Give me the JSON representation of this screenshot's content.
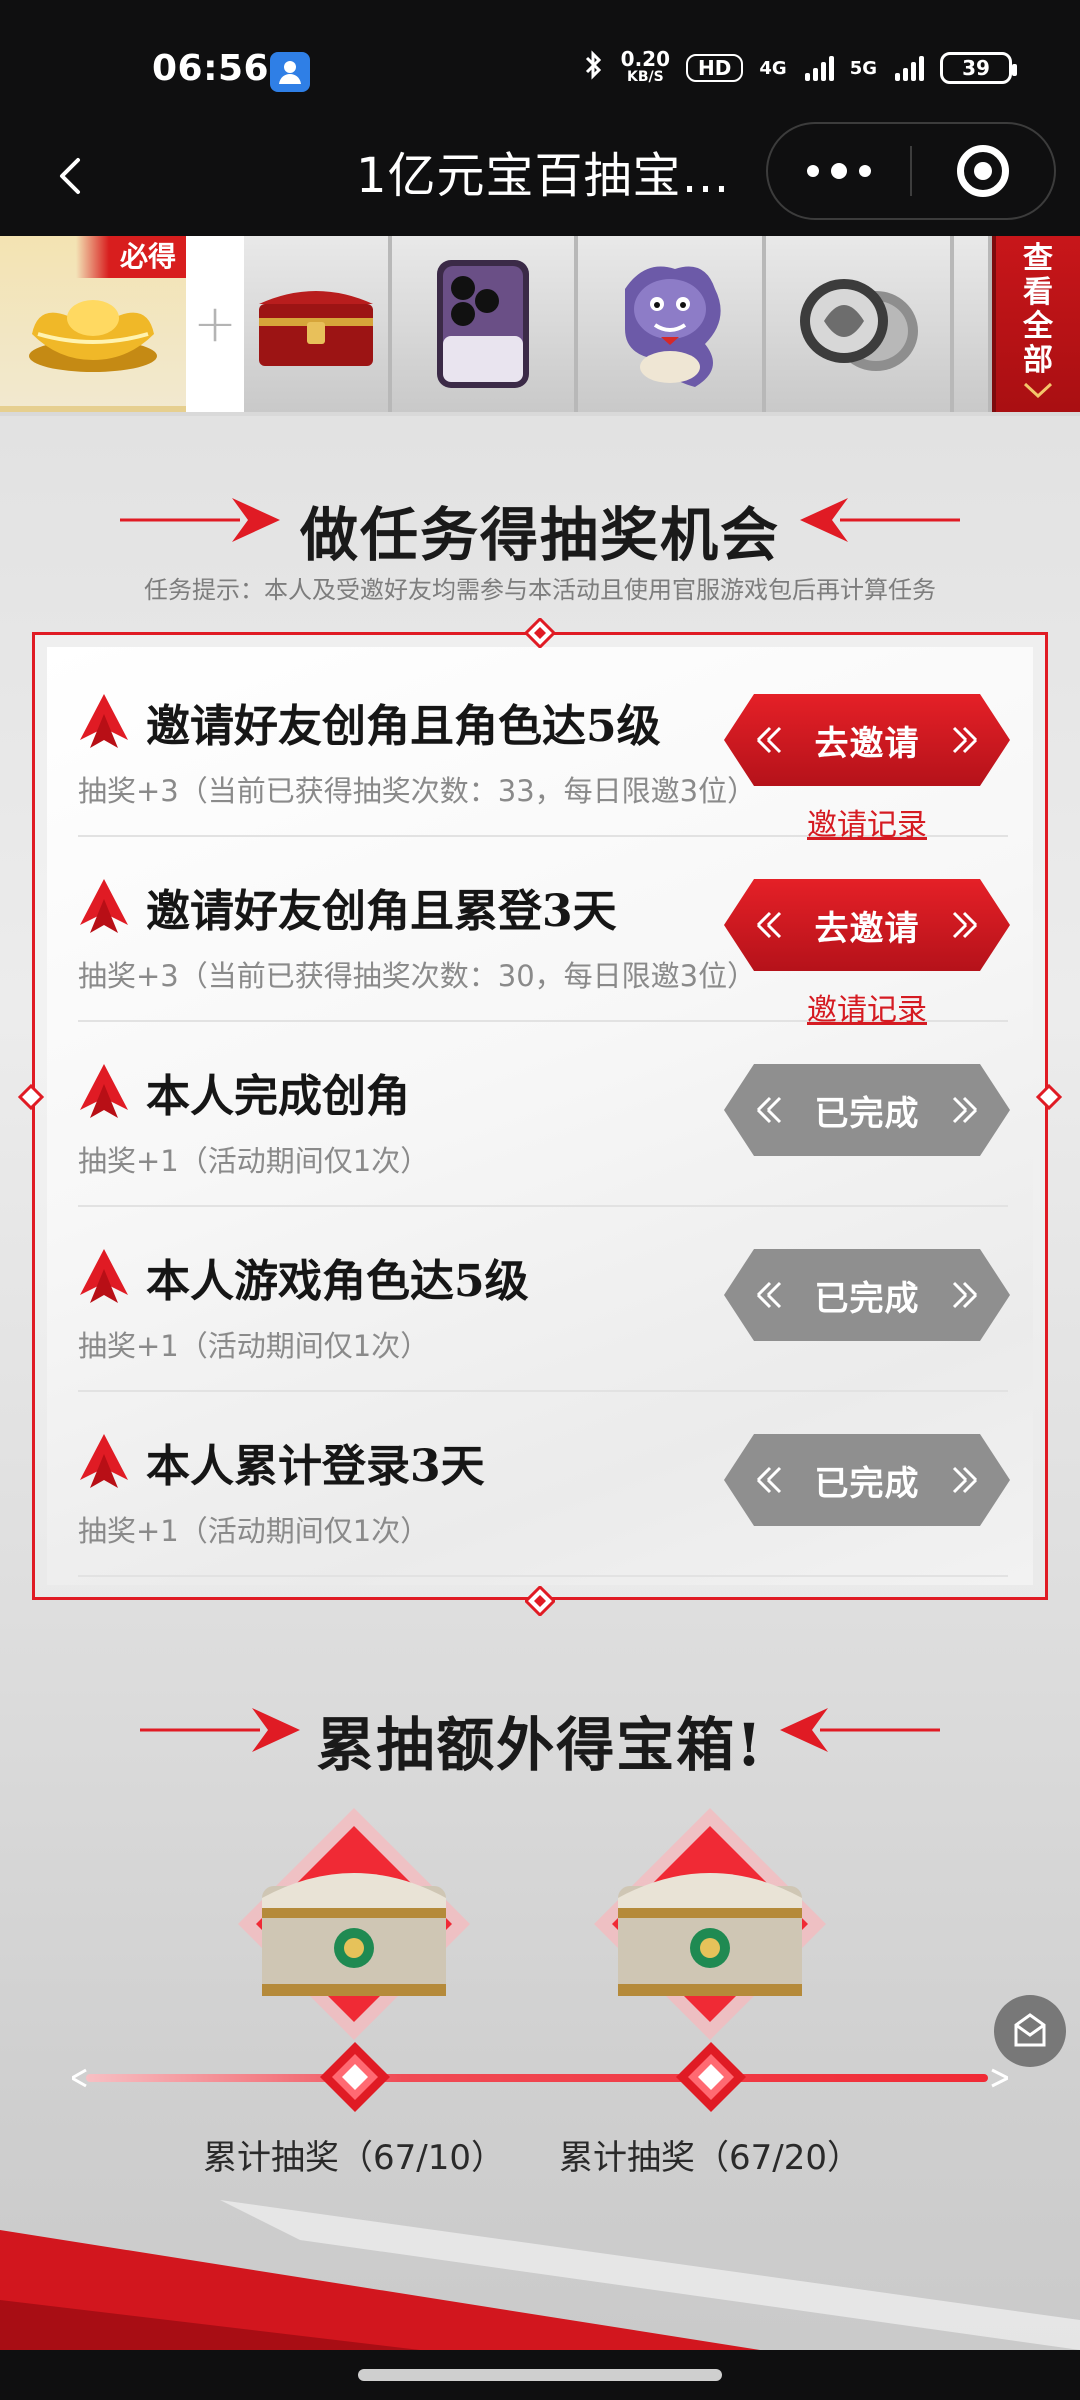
{
  "status_bar": {
    "time": "06:56",
    "app_icon": "person-icon",
    "net_speed_value": "0.20",
    "net_speed_unit": "KB/S",
    "hd_badge": "HD",
    "net_4g": "4G",
    "net_5g": "5G",
    "battery": "39"
  },
  "nav": {
    "title": "1亿元宝百抽宝…",
    "back_icon": "chevron-left-icon",
    "more_icon": "more-dots-icon",
    "close_icon": "target-close-icon"
  },
  "prize_strip": {
    "must_badge": "必得",
    "plus": "+",
    "items": [
      {
        "name": "gold-ingot"
      },
      {
        "name": "red-chest"
      },
      {
        "name": "smartphone"
      },
      {
        "name": "dragon-mascot"
      },
      {
        "name": "silver-coins"
      }
    ],
    "view_all": [
      "查",
      "看",
      "全",
      "部"
    ]
  },
  "tasks_section": {
    "title": "做任务得抽奖机会",
    "hint": "任务提示：本人及受邀好友均需参与本活动且使用官服游戏包后再计算任务",
    "tasks": [
      {
        "title": "邀请好友创角且角色达5级",
        "sub": "抽奖+3（当前已获得抽奖次数：33，每日限邀3位）",
        "button": "去邀请",
        "button_state": "active",
        "link": "邀请记录"
      },
      {
        "title": "邀请好友创角且累登3天",
        "sub": "抽奖+3（当前已获得抽奖次数：30，每日限邀3位）",
        "button": "去邀请",
        "button_state": "active",
        "link": "邀请记录"
      },
      {
        "title": "本人完成创角",
        "sub": "抽奖+1（活动期间仅1次）",
        "button": "已完成",
        "button_state": "done"
      },
      {
        "title": "本人游戏角色达5级",
        "sub": "抽奖+1（活动期间仅1次）",
        "button": "已完成",
        "button_state": "done"
      },
      {
        "title": "本人累计登录3天",
        "sub": "抽奖+1（活动期间仅1次）",
        "button": "已完成",
        "button_state": "done"
      }
    ]
  },
  "chest_section": {
    "title": "累抽额外得宝箱!",
    "milestones": [
      {
        "label": "累计抽奖（67/10）",
        "current": 67,
        "target": 10
      },
      {
        "label": "累计抽奖（67/20）",
        "current": 67,
        "target": 20
      }
    ]
  },
  "colors": {
    "accent_red": "#d51b22",
    "button_done": "#8e8e8e",
    "topbar": "#0f0f10"
  }
}
